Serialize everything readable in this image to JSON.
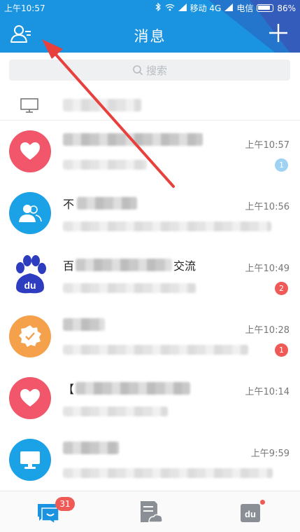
{
  "status_bar": {
    "time": "上午10:57",
    "carrier1": "移动 4G",
    "carrier2": "电信",
    "battery": "86%"
  },
  "header": {
    "title": "消息"
  },
  "search": {
    "placeholder": "搜索"
  },
  "chats": [
    {
      "time": "上午10:57",
      "badge": "1",
      "badge_color": "blue",
      "avatar_color": "#f2566b",
      "avatar_icon": "heart-icon"
    },
    {
      "name_prefix": "不",
      "time": "上午10:56",
      "avatar_color": "#1aa1e6",
      "avatar_icon": "contacts-icon"
    },
    {
      "name_prefix": "百",
      "name_suffix": "交流",
      "time": "上午10:49",
      "badge": "2",
      "badge_color": "red",
      "avatar_color": "#2e3dbf",
      "avatar_icon": "baidu-paw-icon"
    },
    {
      "time": "上午10:28",
      "badge": "1",
      "badge_color": "red",
      "avatar_color": "#f5a04a",
      "avatar_icon": "verified-badge-icon"
    },
    {
      "name_prefix": "【",
      "time": "上午10:14",
      "avatar_color": "#f2566b",
      "avatar_icon": "heart-icon"
    },
    {
      "time": "上午9:59",
      "avatar_color": "#1aa1e6",
      "avatar_icon": "monitor-icon"
    }
  ],
  "tabbar": {
    "messages_badge": "31"
  },
  "colors": {
    "header_blue": "#1a93e0",
    "badge_red": "#f05a56",
    "annotation_arrow": "#e8403c"
  }
}
